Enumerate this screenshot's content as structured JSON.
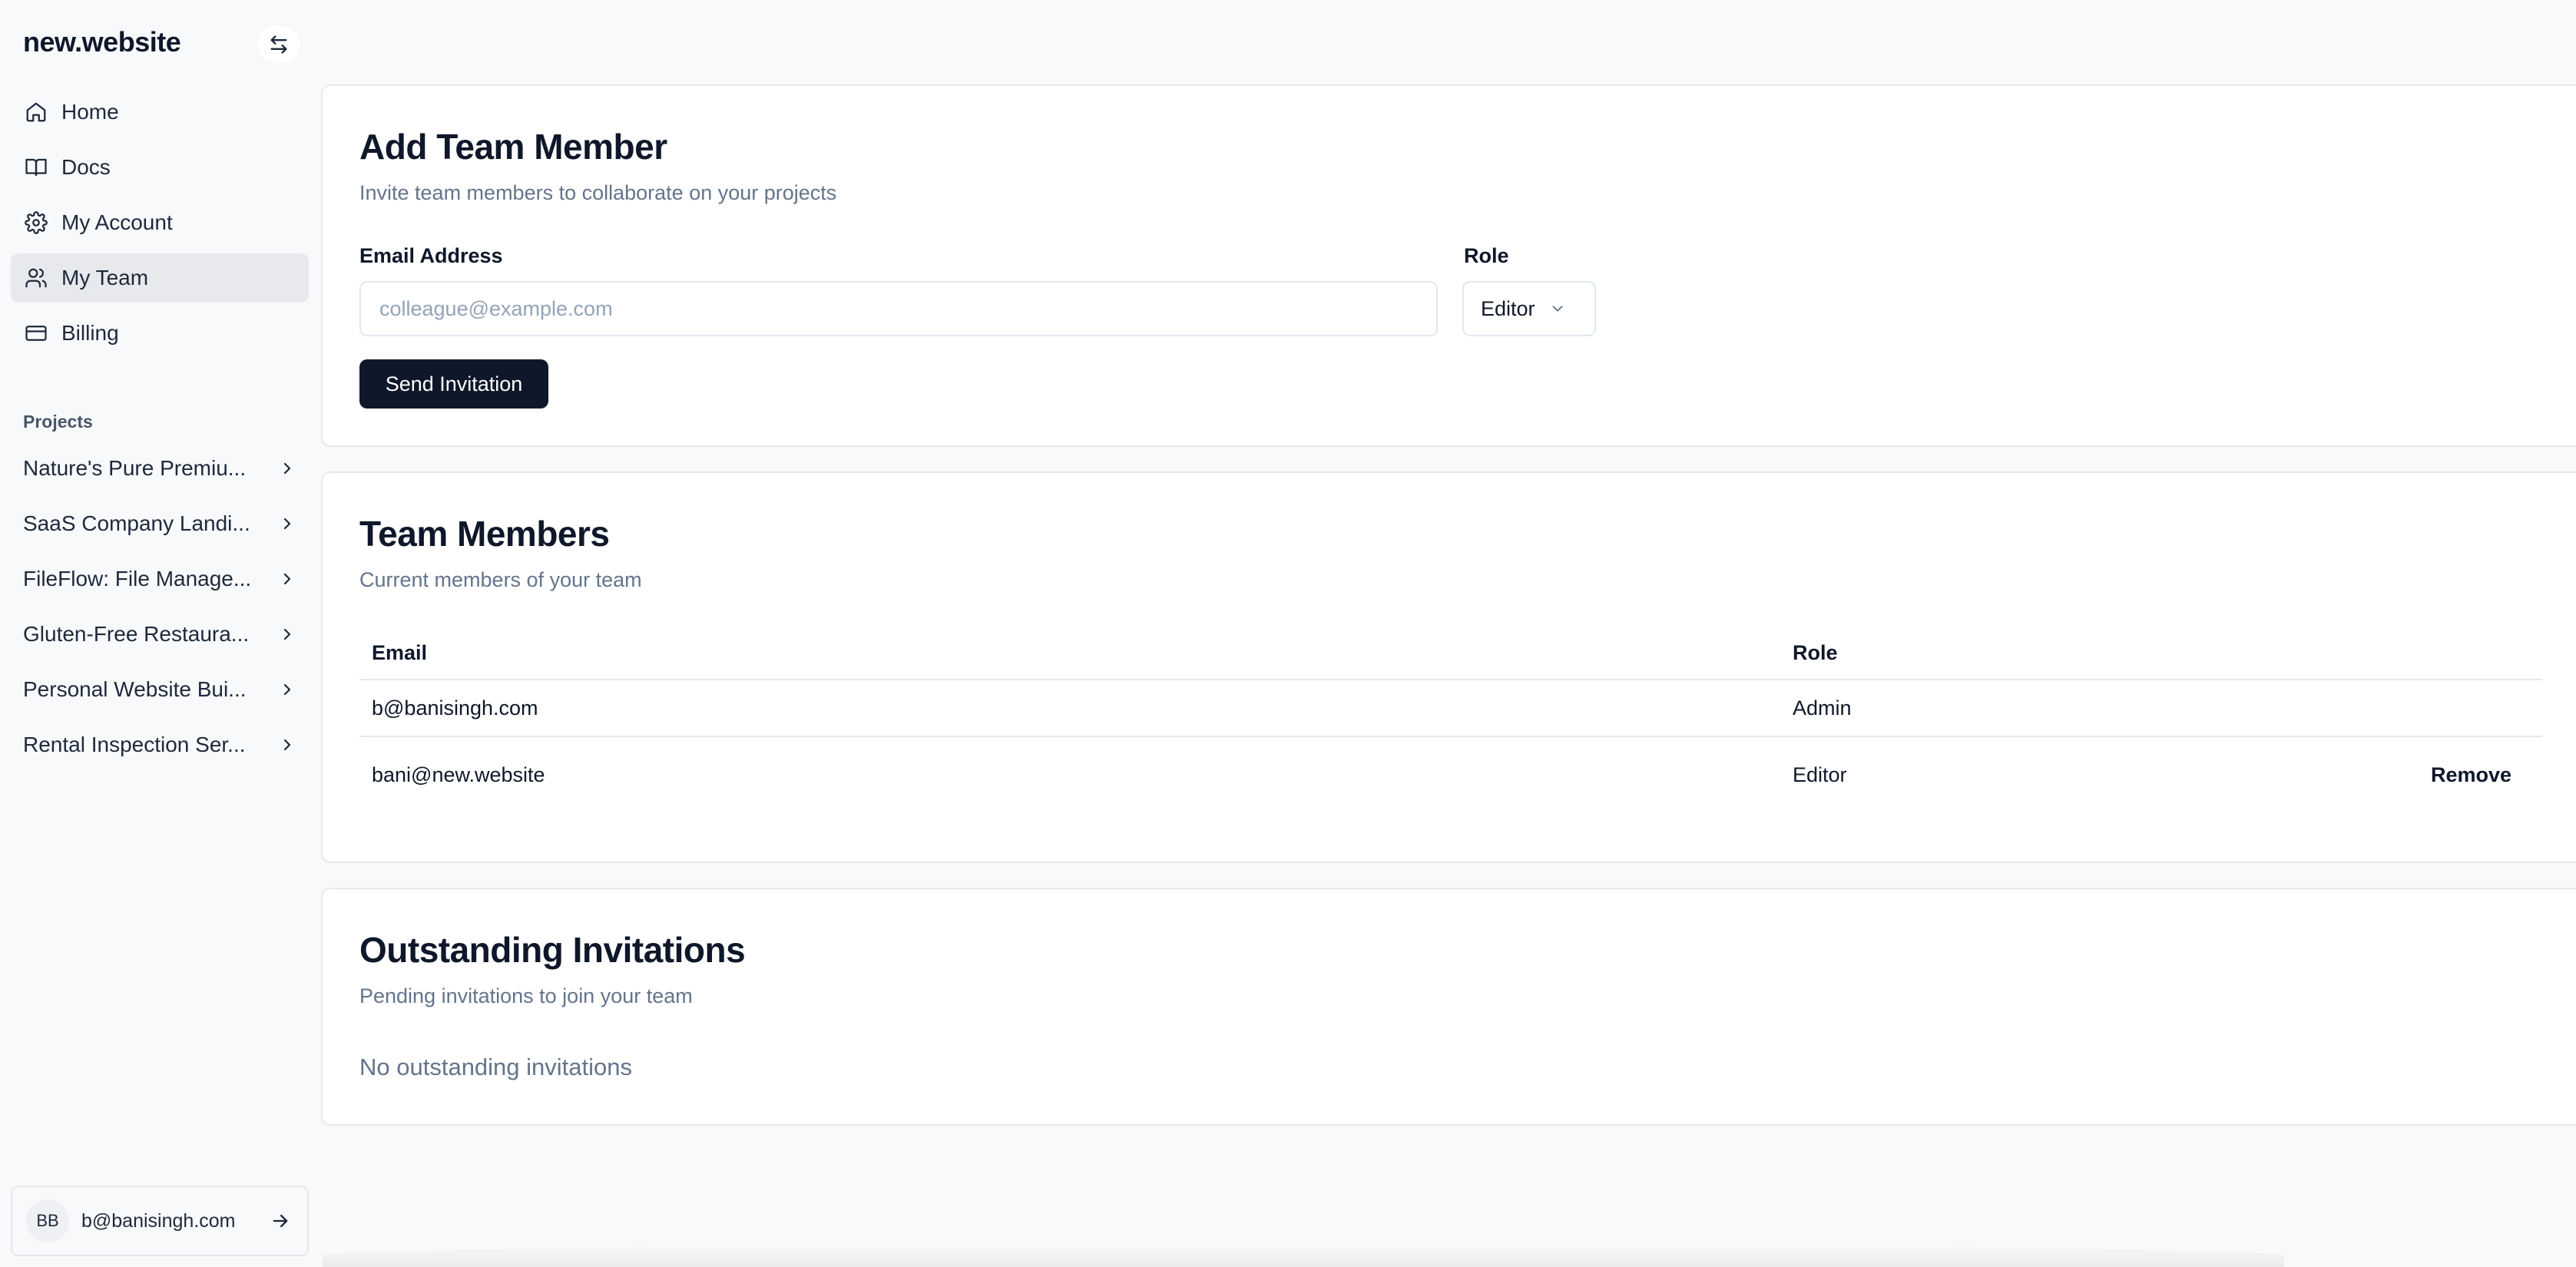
{
  "sidebar": {
    "brand": "new.website",
    "nav": [
      {
        "label": "Home",
        "icon": "home-icon"
      },
      {
        "label": "Docs",
        "icon": "book-icon"
      },
      {
        "label": "My Account",
        "icon": "gear-icon"
      },
      {
        "label": "My Team",
        "icon": "users-icon",
        "active": true
      },
      {
        "label": "Billing",
        "icon": "credit-card-icon"
      }
    ],
    "projects_label": "Projects",
    "projects": [
      {
        "label": "Nature's Pure Premiu..."
      },
      {
        "label": "SaaS Company Landi..."
      },
      {
        "label": "FileFlow: File Manage..."
      },
      {
        "label": "Gluten-Free Restaura..."
      },
      {
        "label": "Personal Website Bui..."
      },
      {
        "label": "Rental Inspection Ser..."
      }
    ],
    "user": {
      "initials": "BB",
      "email": "b@banisingh.com"
    }
  },
  "add_member": {
    "title": "Add Team Member",
    "subtitle": "Invite team members to collaborate on your projects",
    "email_label": "Email Address",
    "email_placeholder": "colleague@example.com",
    "email_value": "",
    "role_label": "Role",
    "role_value": "Editor",
    "send_label": "Send Invitation"
  },
  "team_members": {
    "title": "Team Members",
    "subtitle": "Current members of your team",
    "columns": {
      "email": "Email",
      "role": "Role"
    },
    "rows": [
      {
        "email": "b@banisingh.com",
        "role": "Admin",
        "action": ""
      },
      {
        "email": "bani@new.website",
        "role": "Editor",
        "action": "Remove"
      }
    ]
  },
  "invitations": {
    "title": "Outstanding Invitations",
    "subtitle": "Pending invitations to join your team",
    "empty_text": "No outstanding invitations"
  },
  "colors": {
    "primary": "#0f172a",
    "muted": "#64748b",
    "border": "#e5e7eb",
    "active_bg": "#e8e9ec"
  }
}
